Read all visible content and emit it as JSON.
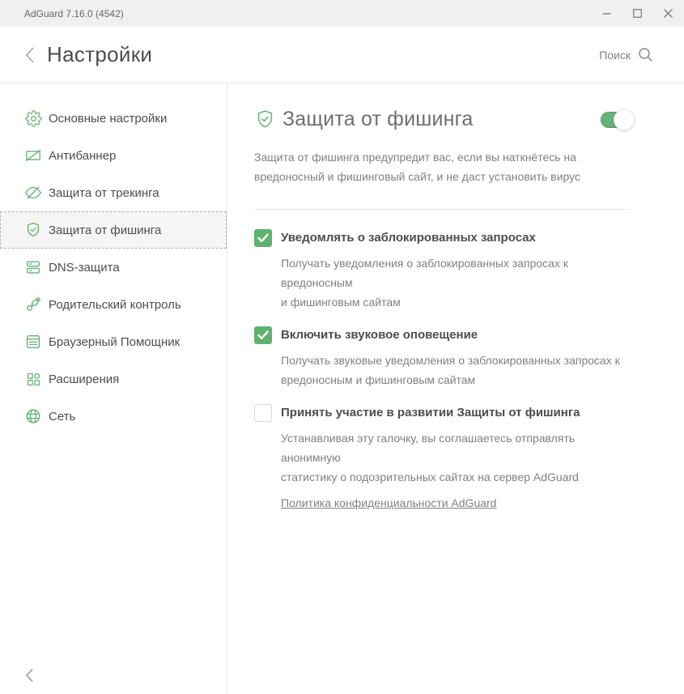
{
  "window": {
    "title": "AdGuard 7.16.0 (4542)",
    "controls": {
      "minimize": "minimize",
      "maximize": "maximize",
      "close": "close"
    }
  },
  "header": {
    "title": "Настройки",
    "search_label": "Поиск"
  },
  "sidebar": {
    "items": [
      {
        "label": "Основные настройки",
        "icon": "gear-icon",
        "selected": false
      },
      {
        "label": "Антибаннер",
        "icon": "antibanner-icon",
        "selected": false
      },
      {
        "label": "Защита от трекинга",
        "icon": "eye-off-icon",
        "selected": false
      },
      {
        "label": "Защита от фишинга",
        "icon": "shield-check-icon",
        "selected": true
      },
      {
        "label": "DNS-защита",
        "icon": "dns-server-icon",
        "selected": false
      },
      {
        "label": "Родительский контроль",
        "icon": "pacifier-icon",
        "selected": false
      },
      {
        "label": "Браузерный Помощник",
        "icon": "browser-icon",
        "selected": false
      },
      {
        "label": "Расширения",
        "icon": "extensions-icon",
        "selected": false
      },
      {
        "label": "Сеть",
        "icon": "globe-icon",
        "selected": false
      }
    ]
  },
  "main": {
    "title": "Защита от фишинга",
    "title_icon": "shield-check-icon",
    "toggle_on": true,
    "description": "Защита от фишинга предупредит вас, если вы наткнётесь на\nвредоносный и фишинговый сайт, и не даст установить вирус",
    "options": [
      {
        "checked": true,
        "label": "Уведомлять о заблокированных запросах",
        "description": "Получать уведомления о заблокированных запросах к вредоносным\nи фишинговым сайтам"
      },
      {
        "checked": true,
        "label": "Включить звуковое оповещение",
        "description": "Получать звуковые уведомления о заблокированных запросах к\nвредоносным и фишинговым сайтам"
      },
      {
        "checked": false,
        "label": "Принять участие в развитии Защиты от фишинга",
        "description": "Устанавливая эту галочку, вы соглашаетесь отправлять анонимную\nстатистику о подозрительных сайтах на сервер AdGuard",
        "link": "Политика конфиденциальности AdGuard"
      }
    ]
  },
  "colors": {
    "accent": "#67b279",
    "checkbox_checked": "#5eb36f",
    "titlebar_bg": "#f0f0f0",
    "text_primary": "#4d4d4d",
    "text_secondary": "#808080",
    "divider": "#e8e8e8"
  }
}
